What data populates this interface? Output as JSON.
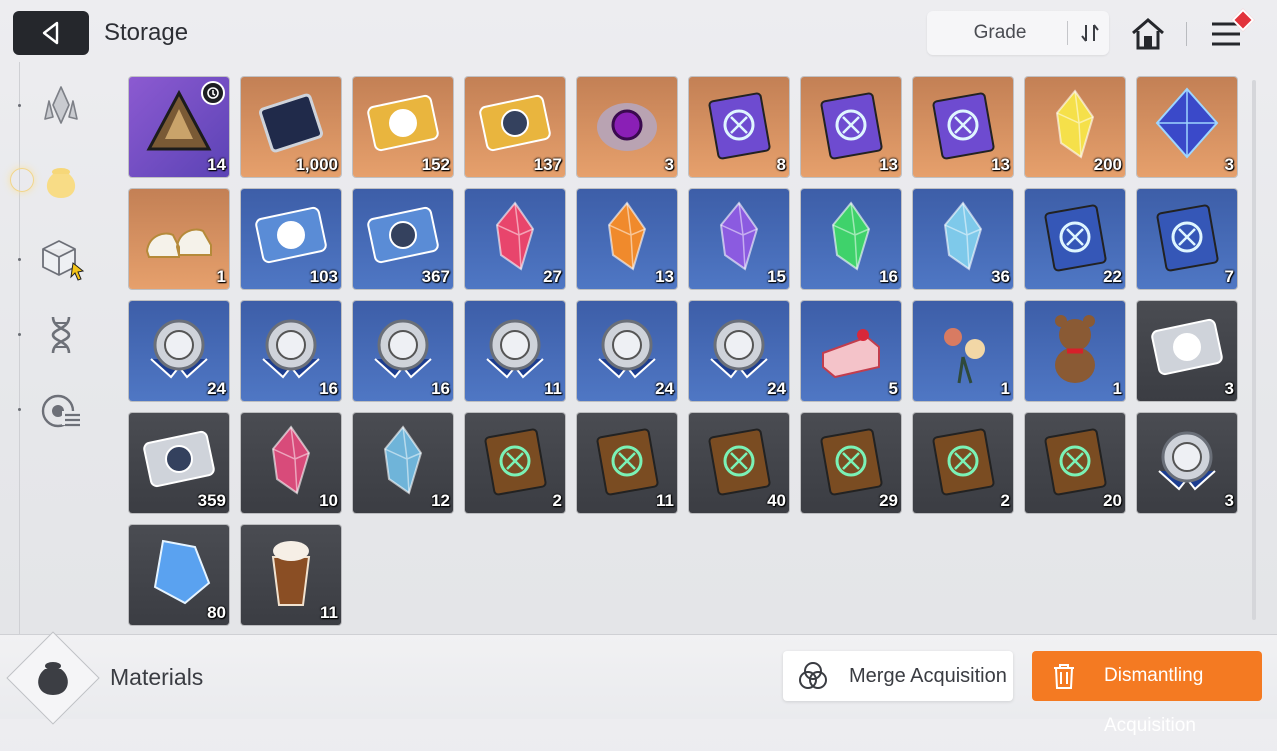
{
  "header": {
    "title": "Storage",
    "sort_label": "Grade",
    "icons": {
      "back": "back-arrow-icon",
      "sort": "sort-toggle-icon",
      "home": "home-icon",
      "menu": "menu-icon"
    }
  },
  "nav": {
    "items": [
      {
        "icon": "crystal-icon",
        "active": false
      },
      {
        "icon": "pouch-icon",
        "active": true
      },
      {
        "icon": "cube-icon",
        "active": false
      },
      {
        "icon": "dna-icon",
        "active": false
      },
      {
        "icon": "target-list-icon",
        "active": false
      }
    ]
  },
  "items": [
    {
      "qty": "14",
      "bg": "purple",
      "icon": "triangle-device",
      "alert": true
    },
    {
      "qty": "1,000",
      "bg": "orange",
      "icon": "data-chip"
    },
    {
      "qty": "152",
      "bg": "orange",
      "icon": "gold-ticket-portrait"
    },
    {
      "qty": "137",
      "bg": "orange",
      "icon": "gold-ticket-star"
    },
    {
      "qty": "3",
      "bg": "orange",
      "icon": "purple-eye-core"
    },
    {
      "qty": "8",
      "bg": "orange",
      "icon": "manual-swords"
    },
    {
      "qty": "13",
      "bg": "orange",
      "icon": "manual-shield"
    },
    {
      "qty": "13",
      "bg": "orange",
      "icon": "manual-wings"
    },
    {
      "qty": "200",
      "bg": "orange",
      "icon": "gold-crystal-shards"
    },
    {
      "qty": "3",
      "bg": "orange",
      "icon": "blue-octahedron"
    },
    {
      "qty": "1",
      "bg": "orange",
      "icon": "sneakers"
    },
    {
      "qty": "103",
      "bg": "blue",
      "icon": "blue-ticket-portrait"
    },
    {
      "qty": "367",
      "bg": "blue",
      "icon": "blue-ticket-star"
    },
    {
      "qty": "27",
      "bg": "blue",
      "icon": "red-crystal"
    },
    {
      "qty": "13",
      "bg": "blue",
      "icon": "orange-crystal"
    },
    {
      "qty": "15",
      "bg": "blue",
      "icon": "purple-crystal"
    },
    {
      "qty": "16",
      "bg": "blue",
      "icon": "green-crystal"
    },
    {
      "qty": "36",
      "bg": "blue",
      "icon": "cyan-crystal"
    },
    {
      "qty": "22",
      "bg": "blue",
      "icon": "blue-manual-swords"
    },
    {
      "qty": "7",
      "bg": "blue",
      "icon": "blue-manual-bolt"
    },
    {
      "qty": "24",
      "bg": "blue",
      "icon": "medal-plus"
    },
    {
      "qty": "16",
      "bg": "blue",
      "icon": "medal-triangle"
    },
    {
      "qty": "16",
      "bg": "blue",
      "icon": "medal-target"
    },
    {
      "qty": "11",
      "bg": "blue",
      "icon": "medal-wings"
    },
    {
      "qty": "24",
      "bg": "blue",
      "icon": "medal-bolt"
    },
    {
      "qty": "24",
      "bg": "blue",
      "icon": "medal-globe"
    },
    {
      "qty": "5",
      "bg": "blue",
      "icon": "strawberry-cake"
    },
    {
      "qty": "1",
      "bg": "blue",
      "icon": "flower-bouquet"
    },
    {
      "qty": "1",
      "bg": "blue",
      "icon": "teddy-bear"
    },
    {
      "qty": "3",
      "bg": "gray",
      "icon": "silver-ticket-portrait"
    },
    {
      "qty": "359",
      "bg": "gray",
      "icon": "silver-ticket-star"
    },
    {
      "qty": "10",
      "bg": "gray",
      "icon": "pink-crystal"
    },
    {
      "qty": "12",
      "bg": "gray",
      "icon": "ice-crystal"
    },
    {
      "qty": "2",
      "bg": "gray",
      "icon": "book-swords"
    },
    {
      "qty": "11",
      "bg": "gray",
      "icon": "book-shield"
    },
    {
      "qty": "40",
      "bg": "gray",
      "icon": "book-target"
    },
    {
      "qty": "29",
      "bg": "gray",
      "icon": "book-wings"
    },
    {
      "qty": "2",
      "bg": "gray",
      "icon": "book-bolt"
    },
    {
      "qty": "20",
      "bg": "gray",
      "icon": "book-globe"
    },
    {
      "qty": "3",
      "bg": "gray",
      "icon": "bronze-medal-bolt"
    },
    {
      "qty": "80",
      "bg": "gray",
      "icon": "blue-gem-cluster"
    },
    {
      "qty": "11",
      "bg": "gray",
      "icon": "iced-coffee"
    }
  ],
  "footer": {
    "category_label": "Materials",
    "category_icon": "pouch-icon",
    "merge_label": "Merge Acquisition",
    "dismantle_label": "Dismantling Acquisition"
  },
  "colors": {
    "accent": "#f47a22",
    "dark": "#25272c"
  }
}
